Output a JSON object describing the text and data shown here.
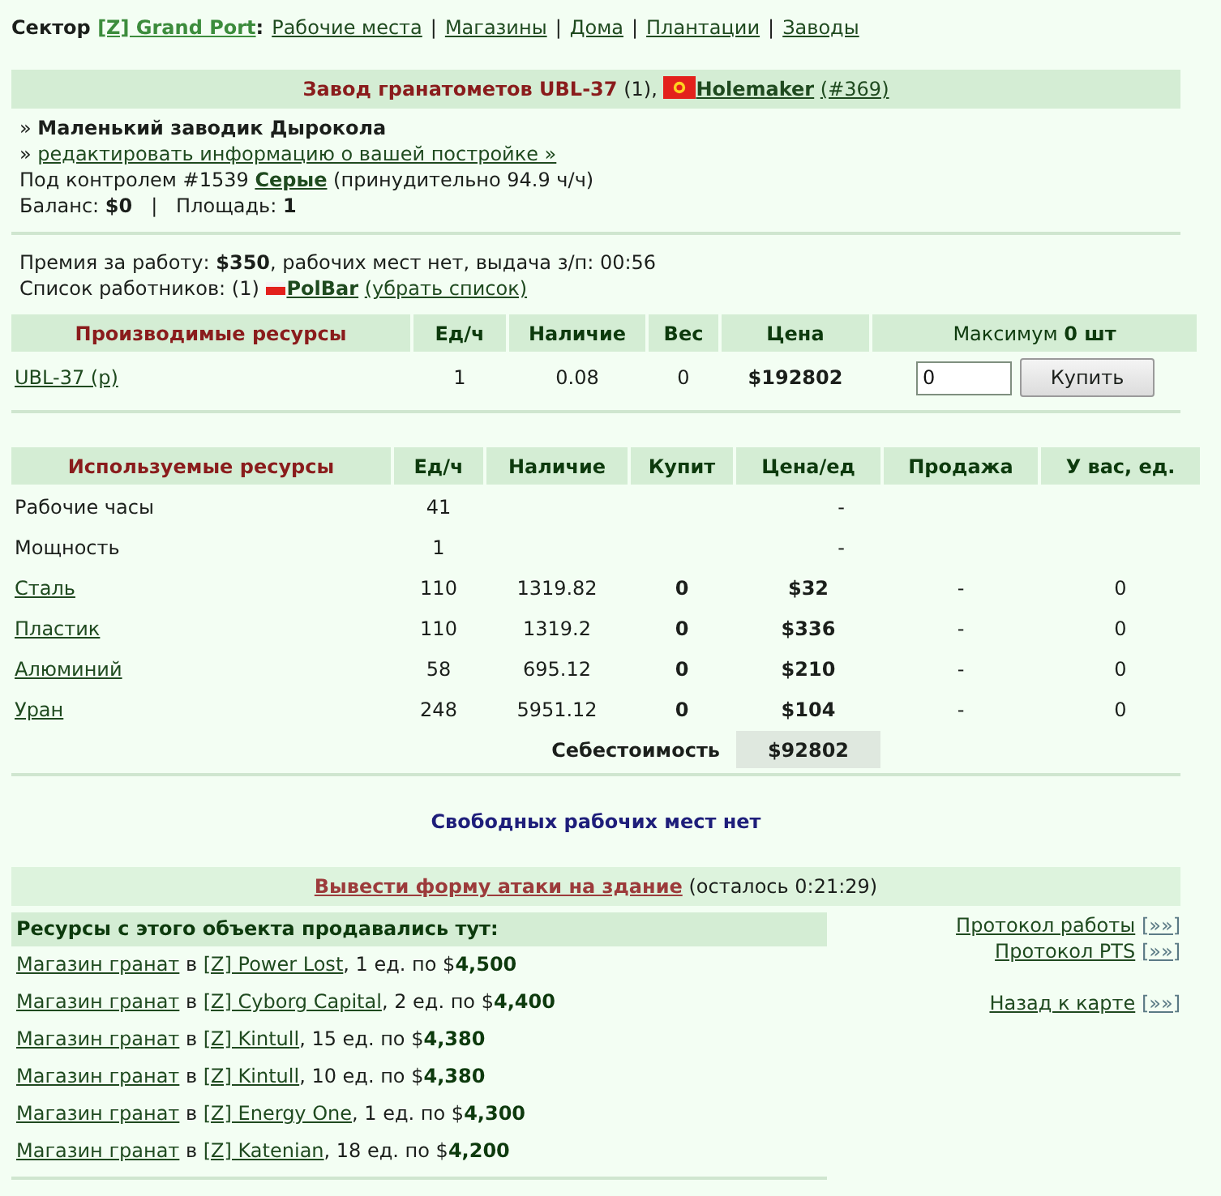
{
  "breadcrumb": {
    "prefix": "Сектор",
    "sector": "[Z] Grand Port",
    "suffix": ":",
    "separator": "|",
    "links": [
      "Рабочие места",
      "Магазины",
      "Дома",
      "Плантации",
      "Заводы"
    ]
  },
  "building": {
    "name": "Завод гранатометов UBL-37",
    "count": "(1),",
    "owner": "Holemaker",
    "owner_id": "(#369)"
  },
  "info": {
    "subtitle": "» **Маленький заводик Дырокола**",
    "edit": {
      "bullet": "»",
      "link": "редактировать информацию о вашей постройке »"
    },
    "control": {
      "before": "Под контролем #1539",
      "link": "Серые",
      "after": "(принудительно 94.9 ч/ч)"
    },
    "balance": "Баланс: **$0**   |   Площадь: **1**"
  },
  "work": {
    "bonus": "Премия за работу: **$350**, рабочих мест нет, выдача з/п: 00:56",
    "workers": {
      "before": "Список работников: (1)",
      "worker": "PolBar",
      "remove": "(убрать список)"
    }
  },
  "produced": {
    "columns": [
      "Производимые ресурсы",
      "Ед/ч",
      "Наличие",
      "Вес",
      "Цена",
      "Максимум **0 шт**"
    ],
    "rows": [
      {
        "name": "UBL-37 (p)",
        "per_hour": "1",
        "stock": "0.08",
        "weight": "0",
        "price": "$192802",
        "quantity": "0",
        "buy": "Купить"
      }
    ]
  },
  "used": {
    "columns": [
      "Используемые ресурсы",
      "Ед/ч",
      "Наличие",
      "Купит",
      "Цена/ед",
      "Продажа",
      "У вас, ед."
    ],
    "rows": [
      {
        "kind": "service",
        "name": "Рабочие часы",
        "per_hour": "41",
        "price": "-"
      },
      {
        "kind": "service",
        "name": "Мощность",
        "per_hour": "1",
        "price": "-"
      },
      {
        "kind": "resource",
        "name": "Сталь",
        "per_hour": "110",
        "stock": "1319.82",
        "buy": "0",
        "price": "$32",
        "sale": "-",
        "owned": "0"
      },
      {
        "kind": "resource",
        "name": "Пластик",
        "per_hour": "110",
        "stock": "1319.2",
        "buy": "0",
        "price": "$336",
        "sale": "-",
        "owned": "0"
      },
      {
        "kind": "resource",
        "name": "Алюминий",
        "per_hour": "58",
        "stock": "695.12",
        "buy": "0",
        "price": "$210",
        "sale": "-",
        "owned": "0"
      },
      {
        "kind": "resource",
        "name": "Уран",
        "per_hour": "248",
        "stock": "5951.12",
        "buy": "0",
        "price": "$104",
        "sale": "-",
        "owned": "0"
      }
    ],
    "total": {
      "label": "Себестоимость",
      "value": "$92802"
    }
  },
  "vacancies": "Свободных рабочих мест нет",
  "attack": {
    "link": "Вывести форму атаки на здание",
    "remaining": "(осталось 0:21:29)"
  },
  "sales": {
    "title": "Ресурсы с этого объекта продавались тут:",
    "rows": [
      {
        "shop": "Магазин гранат",
        "connector": "в",
        "sector": "[Z] Power Lost",
        "detail": ", 1 ед. по $**4,500**"
      },
      {
        "shop": "Магазин гранат",
        "connector": "в",
        "sector": "[Z] Cyborg Capital",
        "detail": ", 2 ед. по $**4,400**"
      },
      {
        "shop": "Магазин гранат",
        "connector": "в",
        "sector": "[Z] Kintull",
        "detail": ", 15 ед. по $**4,380**"
      },
      {
        "shop": "Магазин гранат",
        "connector": "в",
        "sector": "[Z] Kintull",
        "detail": ", 10 ед. по $**4,380**"
      },
      {
        "shop": "Магазин гранат",
        "connector": "в",
        "sector": "[Z] Energy One",
        "detail": ", 1 ед. по $**4,300**"
      },
      {
        "shop": "Магазин гранат",
        "connector": "в",
        "sector": "[Z] Katenian",
        "detail": ", 18 ед. по $**4,200**"
      }
    ]
  },
  "side_links": [
    {
      "links": [
        {
          "text": "Протокол работы",
          "more": "[»»]"
        },
        {
          "text": "Протокол PTS",
          "more": "[»»]"
        }
      ]
    },
    {
      "links": [
        {
          "text": "Назад к карте",
          "more": "[»»]"
        }
      ]
    }
  ]
}
